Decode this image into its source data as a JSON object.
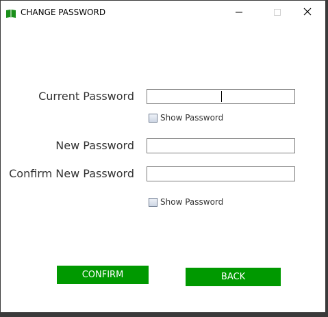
{
  "window": {
    "title": "CHANGE PASSWORD",
    "icons": {
      "app": "book-icon",
      "minimize": "minimize-icon",
      "maximize": "maximize-icon",
      "close": "close-icon"
    }
  },
  "form": {
    "current_password": {
      "label": "Current Password",
      "value": ""
    },
    "show_password_1": {
      "label": "Show Password",
      "checked": false
    },
    "new_password": {
      "label": "New Password",
      "value": ""
    },
    "confirm_new_password": {
      "label": "Confirm New Password",
      "value": ""
    },
    "show_password_2": {
      "label": "Show Password",
      "checked": false
    }
  },
  "buttons": {
    "confirm": "CONFIRM",
    "back": "BACK"
  },
  "colors": {
    "button_bg": "#009900",
    "button_text": "#ffffff",
    "app_icon": "#1a8f1a"
  }
}
